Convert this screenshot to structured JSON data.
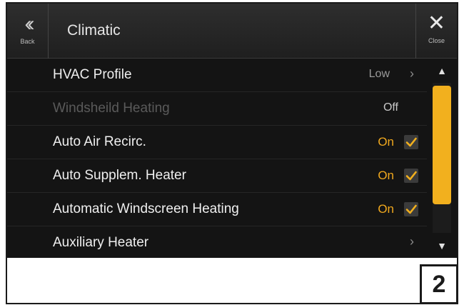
{
  "header": {
    "back_label": "Back",
    "back_icon": "double-chevron-left-icon",
    "title": "Climatic",
    "close_label": "Close",
    "close_icon": "close-icon"
  },
  "rows": [
    {
      "label": "HVAC Profile",
      "value": "Low",
      "arrow": "›",
      "enabled": true
    },
    {
      "label": "Windsheild Heating",
      "value": "Off",
      "enabled": false
    },
    {
      "label": "Auto Air Recirc.",
      "value": "On",
      "checked": true,
      "enabled": true
    },
    {
      "label": "Auto Supplem. Heater",
      "value": "On",
      "checked": true,
      "enabled": true
    },
    {
      "label": "Automatic Windscreen Heating",
      "value": "On",
      "checked": true,
      "enabled": true
    },
    {
      "label": "Auxiliary Heater",
      "arrow": "›",
      "enabled": true
    }
  ],
  "scrollbar": {
    "up_glyph": "▲",
    "down_glyph": "▼"
  },
  "page_number": "2",
  "colors": {
    "accent": "#f2b01e",
    "background": "#141414",
    "text": "#efefef",
    "disabled": "#5a5a5a"
  }
}
